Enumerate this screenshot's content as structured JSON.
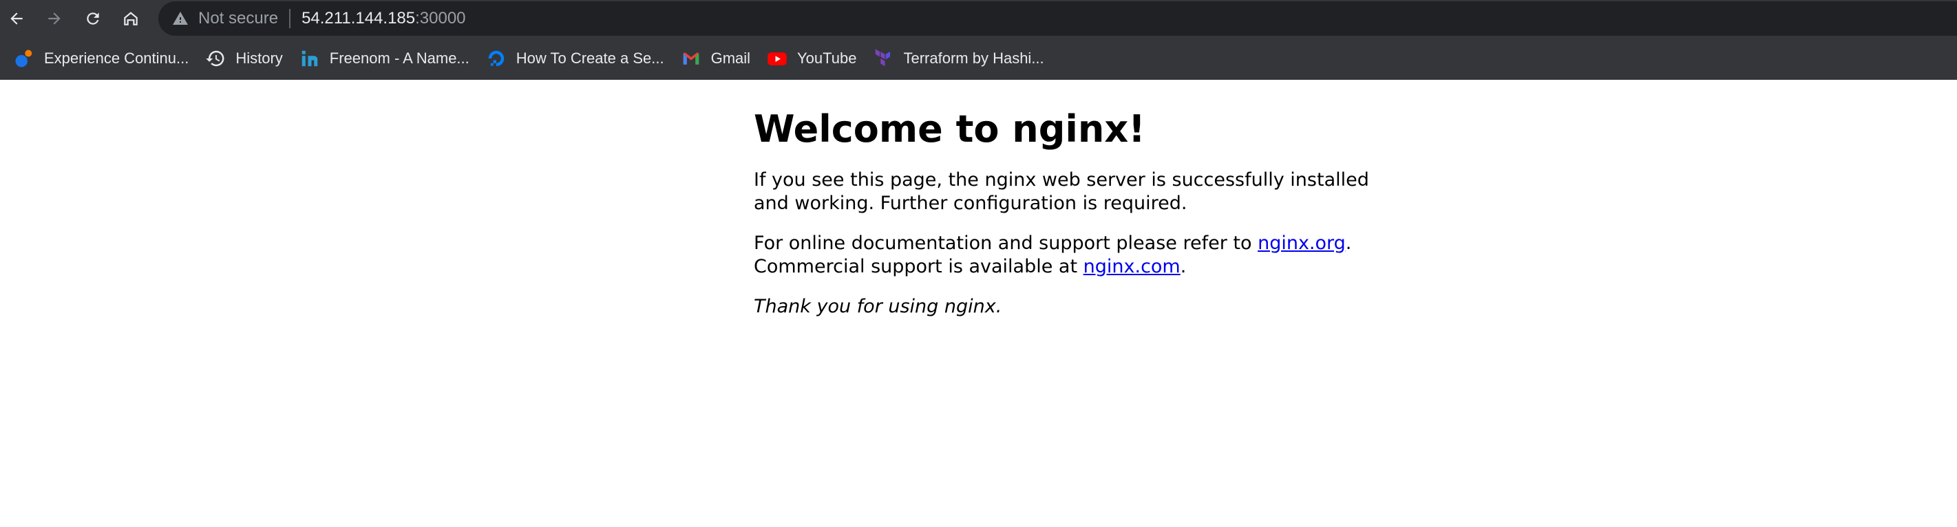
{
  "browser": {
    "address_bar": {
      "security_label": "Not secure",
      "host": "54.211.144.185",
      "port": ":30000"
    },
    "nav": {
      "back_icon": "arrow-left-icon",
      "forward_icon": "arrow-right-icon",
      "reload_icon": "reload-icon",
      "home_icon": "home-icon"
    },
    "bookmarks": [
      {
        "label": "Experience Continu...",
        "icon": "experience-icon",
        "color": "#1a73e8"
      },
      {
        "label": "History",
        "icon": "history-icon",
        "color": "#e8eaed"
      },
      {
        "label": "Freenom - A Name...",
        "icon": "freenom-icon",
        "color": "#2a9fd6"
      },
      {
        "label": "How To Create a Se...",
        "icon": "digitalocean-icon",
        "color": "#0080ff"
      },
      {
        "label": "Gmail",
        "icon": "gmail-icon",
        "color": "#ea4335"
      },
      {
        "label": "YouTube",
        "icon": "youtube-icon",
        "color": "#ff0000"
      },
      {
        "label": "Terraform by Hashi...",
        "icon": "terraform-icon",
        "color": "#7b42bc"
      }
    ]
  },
  "page": {
    "title": "Welcome to nginx!",
    "para1": "If you see this page, the nginx web server is successfully installed and working. Further configuration is required.",
    "para2_prefix": "For online documentation and support please refer to ",
    "link_org": "nginx.org",
    "para2_mid": ".",
    "para2_line2": "Commercial support is available at ",
    "link_com": "nginx.com",
    "para2_end": ".",
    "thanks": "Thank you for using nginx."
  }
}
